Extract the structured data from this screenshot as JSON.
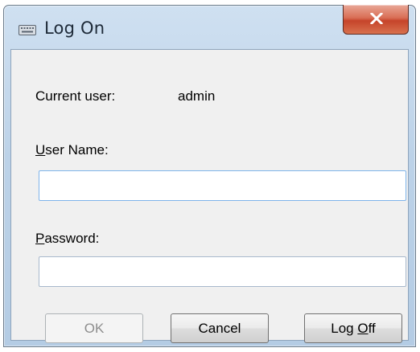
{
  "window": {
    "title": "Log On",
    "title_icon": "keyboard-icon",
    "close_icon": "close-icon"
  },
  "form": {
    "current_user_label": "Current user:",
    "current_user_value": "admin",
    "username_label_accel": "U",
    "username_label_rest": "ser Name:",
    "username_value": "",
    "password_label_accel": "P",
    "password_label_rest": "assword:",
    "password_value": ""
  },
  "buttons": {
    "ok_label": "OK",
    "cancel_label": "Cancel",
    "logoff_label_pre": "Log ",
    "logoff_label_accel": "O",
    "logoff_label_post": "ff"
  },
  "colors": {
    "close_button": "#c6442a",
    "title_bar": "#bcd2e8",
    "client_bg": "#f0f0f0"
  }
}
